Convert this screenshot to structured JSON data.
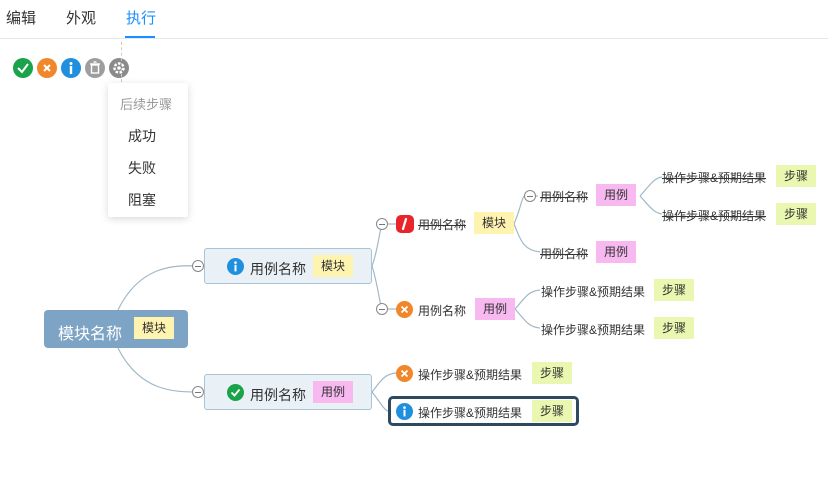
{
  "tabs": [
    {
      "label": "编辑"
    },
    {
      "label": "外观"
    },
    {
      "label": "执行"
    }
  ],
  "dropdown": {
    "title": "后续步骤",
    "items": [
      {
        "label": "成功"
      },
      {
        "label": "失败"
      },
      {
        "label": "阻塞"
      }
    ]
  },
  "colors": {
    "accent": "#1890ff",
    "success": "#1aa34a",
    "fail": "#f0872a",
    "info": "#1f8fde",
    "block": "#e8262a",
    "module_tag": "#fff3b0",
    "case_tag": "#f8b8f0",
    "step_tag": "#eaf7b0"
  },
  "mindmap": {
    "root": {
      "label": "模块名称",
      "tag": "模块"
    },
    "l1_top": {
      "label": "用例名称",
      "tag": "模块",
      "status": "info-icon"
    },
    "l1_bottom": {
      "label": "用例名称",
      "tag": "用例",
      "status": "check-icon"
    },
    "l2_module": {
      "label": "用例名称",
      "tag": "模块",
      "status": "blocked-icon"
    },
    "l2_case_fail": {
      "label": "用例名称",
      "tag": "用例",
      "status": "x-icon"
    },
    "l3_case_a": {
      "label": "用例名称",
      "tag": "用例"
    },
    "l3_case_b": {
      "label": "用例名称",
      "tag": "用例"
    },
    "l4_step_a": {
      "label": "操作步骤&预期结果",
      "tag": "步骤"
    },
    "l4_step_b": {
      "label": "操作步骤&预期结果",
      "tag": "步骤"
    },
    "l3_step_c": {
      "label": "操作步骤&预期结果",
      "tag": "步骤"
    },
    "l3_step_d": {
      "label": "操作步骤&预期结果",
      "tag": "步骤"
    },
    "l2_step_fail": {
      "label": "操作步骤&预期结果",
      "tag": "步骤",
      "status": "x-icon"
    },
    "l2_step_info": {
      "label": "操作步骤&预期结果",
      "tag": "步骤",
      "status": "info-icon"
    }
  }
}
